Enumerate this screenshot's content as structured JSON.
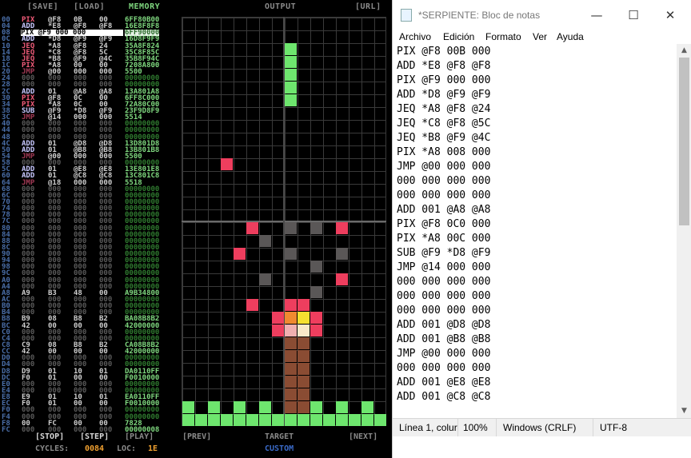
{
  "emulator": {
    "toolbar": {
      "save": "[SAVE]",
      "load": "[LOAD]",
      "memory": "MEMORY",
      "output": "OUTPUT",
      "url": "[URL]"
    },
    "rows": [
      [
        "00",
        "PIX",
        "@F8",
        "0B",
        "00",
        "6FF80B00"
      ],
      [
        "04",
        "ADD",
        "*E8",
        "@F8",
        "@F8",
        "16E8F8F8"
      ],
      [
        "08",
        "PIX",
        "@F9",
        "000",
        "000",
        "6FF90000"
      ],
      [
        "0C",
        "ADD",
        "*D8",
        "@F9",
        "@F9",
        "16D8F9F9"
      ],
      [
        "10",
        "JEQ",
        "*A8",
        "@F8",
        "24",
        "35A8F824"
      ],
      [
        "14",
        "JEQ",
        "*C8",
        "@F8",
        "5C",
        "35C8F85C"
      ],
      [
        "18",
        "JEQ",
        "*B8",
        "@F9",
        "@4C",
        "35B8F94C"
      ],
      [
        "1C",
        "PIX",
        "*A8",
        "00",
        "00",
        "7208A800"
      ],
      [
        "20",
        "JMP",
        "@00",
        "000",
        "000",
        "5500"
      ],
      [
        "24",
        "000",
        "000",
        "000",
        "000",
        "00000000"
      ],
      [
        "28",
        "000",
        "000",
        "000",
        "000",
        "00000000"
      ],
      [
        "2C",
        "ADD",
        "01",
        "@A8",
        "@A8",
        "13A801A8"
      ],
      [
        "30",
        "PIX",
        "@F8",
        "0C",
        "00",
        "6FF8C000"
      ],
      [
        "34",
        "PIX",
        "*A8",
        "0C",
        "00",
        "72A80C00"
      ],
      [
        "38",
        "SUB",
        "@F9",
        "*D8",
        "@F9",
        "23F9D8F9"
      ],
      [
        "3C",
        "JMP",
        "@14",
        "000",
        "000",
        "5514"
      ],
      [
        "40",
        "000",
        "000",
        "000",
        "000",
        "00000000"
      ],
      [
        "44",
        "000",
        "000",
        "000",
        "000",
        "00000000"
      ],
      [
        "48",
        "000",
        "000",
        "000",
        "000",
        "00000000"
      ],
      [
        "4C",
        "ADD",
        "01",
        "@D8",
        "@D8",
        "13D801D8"
      ],
      [
        "50",
        "ADD",
        "01",
        "@B8",
        "@B8",
        "13B801B8"
      ],
      [
        "54",
        "JMP",
        "@00",
        "000",
        "000",
        "5500"
      ],
      [
        "58",
        "000",
        "000",
        "000",
        "000",
        "00000000"
      ],
      [
        "5C",
        "ADD",
        "01",
        "@E8",
        "@E8",
        "13E801E8"
      ],
      [
        "60",
        "ADD",
        "01",
        "@C8",
        "@C8",
        "13C801C8"
      ],
      [
        "64",
        "JMP",
        "@18",
        "000",
        "000",
        "5518"
      ],
      [
        "68",
        "000",
        "000",
        "000",
        "000",
        "00000000"
      ],
      [
        "6C",
        "000",
        "000",
        "000",
        "000",
        "00000000"
      ],
      [
        "70",
        "000",
        "000",
        "000",
        "000",
        "00000000"
      ],
      [
        "74",
        "000",
        "000",
        "000",
        "000",
        "00000000"
      ],
      [
        "78",
        "000",
        "000",
        "000",
        "000",
        "00000000"
      ],
      [
        "7C",
        "000",
        "000",
        "000",
        "000",
        "00000000"
      ],
      [
        "80",
        "000",
        "000",
        "000",
        "000",
        "00000000"
      ],
      [
        "84",
        "000",
        "000",
        "000",
        "000",
        "00000000"
      ],
      [
        "88",
        "000",
        "000",
        "000",
        "000",
        "00000000"
      ],
      [
        "8C",
        "000",
        "000",
        "000",
        "000",
        "00000000"
      ],
      [
        "90",
        "000",
        "000",
        "000",
        "000",
        "00000000"
      ],
      [
        "94",
        "000",
        "000",
        "000",
        "000",
        "00000000"
      ],
      [
        "98",
        "000",
        "000",
        "000",
        "000",
        "00000000"
      ],
      [
        "9C",
        "000",
        "000",
        "000",
        "000",
        "00000000"
      ],
      [
        "A0",
        "000",
        "000",
        "000",
        "000",
        "00000000"
      ],
      [
        "A4",
        "000",
        "000",
        "000",
        "000",
        "00000000"
      ],
      [
        "A8",
        "A9",
        "B3",
        "48",
        "00",
        "A9B34800"
      ],
      [
        "AC",
        "000",
        "000",
        "000",
        "000",
        "00000000"
      ],
      [
        "B0",
        "000",
        "000",
        "000",
        "000",
        "00000000"
      ],
      [
        "B4",
        "000",
        "000",
        "000",
        "000",
        "00000000"
      ],
      [
        "B8",
        "B9",
        "08",
        "B8",
        "B2",
        "BA08B8B2"
      ],
      [
        "BC",
        "42",
        "00",
        "00",
        "00",
        "42000000"
      ],
      [
        "C0",
        "000",
        "000",
        "000",
        "000",
        "00000000"
      ],
      [
        "C4",
        "000",
        "000",
        "000",
        "000",
        "00000000"
      ],
      [
        "C8",
        "C9",
        "08",
        "B8",
        "B2",
        "CA08B8B2"
      ],
      [
        "CC",
        "42",
        "00",
        "00",
        "00",
        "42000000"
      ],
      [
        "D0",
        "000",
        "000",
        "000",
        "000",
        "00000000"
      ],
      [
        "D4",
        "000",
        "000",
        "000",
        "000",
        "00000000"
      ],
      [
        "D8",
        "D9",
        "01",
        "10",
        "01",
        "DA0110FF"
      ],
      [
        "DC",
        "F0",
        "01",
        "00",
        "00",
        "F0010000"
      ],
      [
        "E0",
        "000",
        "000",
        "000",
        "000",
        "00000000"
      ],
      [
        "E4",
        "000",
        "000",
        "000",
        "000",
        "00000000"
      ],
      [
        "E8",
        "E9",
        "01",
        "10",
        "01",
        "EA0110FF"
      ],
      [
        "EC",
        "F0",
        "01",
        "00",
        "00",
        "F0010000"
      ],
      [
        "F0",
        "000",
        "000",
        "000",
        "000",
        "00000000"
      ],
      [
        "F4",
        "000",
        "000",
        "000",
        "000",
        "00000000"
      ],
      [
        "F8",
        "00",
        "FC",
        "00",
        "00",
        "7828"
      ],
      [
        "FC",
        "000",
        "000",
        "000",
        "000",
        "00000008"
      ]
    ],
    "selected_row": 2,
    "selected_text": "PIX @F9 000 000",
    "bottom": {
      "stop": "[STOP]",
      "step": "[STEP]",
      "play": "[PLAY]",
      "prev": "[PREV]",
      "target_label": "TARGET",
      "next": "[NEXT]",
      "cycles_label": "CYCLES:",
      "cycles_value": "0084",
      "loc_label": "LOC:",
      "loc_value": "1E",
      "target_value": "CUSTOM"
    },
    "colors": {
      "green": "#6ee66e",
      "red": "#ee3e5e",
      "gray": "#5a5757",
      "brown": "#8a4c33",
      "orange": "#f08a30",
      "yellow": "#f5e030",
      "cream": "#f8e8c8",
      "pink": "#f0b0b0"
    },
    "pixels": [
      [
        8,
        2,
        "green"
      ],
      [
        8,
        3,
        "green"
      ],
      [
        8,
        4,
        "green"
      ],
      [
        8,
        5,
        "green"
      ],
      [
        8,
        6,
        "green"
      ],
      [
        3,
        11,
        "red"
      ],
      [
        5,
        16,
        "red"
      ],
      [
        8,
        16,
        "gray"
      ],
      [
        10,
        16,
        "gray"
      ],
      [
        12,
        16,
        "red"
      ],
      [
        6,
        17,
        "gray"
      ],
      [
        4,
        18,
        "red"
      ],
      [
        8,
        18,
        "gray"
      ],
      [
        12,
        18,
        "gray"
      ],
      [
        10,
        19,
        "gray"
      ],
      [
        6,
        20,
        "gray"
      ],
      [
        12,
        20,
        "red"
      ],
      [
        10,
        21,
        "gray"
      ],
      [
        5,
        22,
        "red"
      ],
      [
        8,
        22,
        "red"
      ],
      [
        9,
        22,
        "red"
      ],
      [
        7,
        23,
        "red"
      ],
      [
        8,
        23,
        "orange"
      ],
      [
        9,
        23,
        "yellow"
      ],
      [
        10,
        23,
        "red"
      ],
      [
        7,
        24,
        "red"
      ],
      [
        8,
        24,
        "pink"
      ],
      [
        9,
        24,
        "cream"
      ],
      [
        10,
        24,
        "red"
      ],
      [
        8,
        25,
        "brown"
      ],
      [
        9,
        25,
        "brown"
      ],
      [
        8,
        26,
        "brown"
      ],
      [
        9,
        26,
        "brown"
      ],
      [
        8,
        27,
        "brown"
      ],
      [
        9,
        27,
        "brown"
      ],
      [
        8,
        28,
        "brown"
      ],
      [
        9,
        28,
        "brown"
      ],
      [
        8,
        29,
        "brown"
      ],
      [
        9,
        29,
        "brown"
      ],
      [
        8,
        30,
        "brown"
      ],
      [
        9,
        30,
        "brown"
      ],
      [
        0,
        30,
        "green"
      ],
      [
        2,
        30,
        "green"
      ],
      [
        4,
        30,
        "green"
      ],
      [
        6,
        30,
        "green"
      ],
      [
        10,
        30,
        "green"
      ],
      [
        12,
        30,
        "green"
      ],
      [
        14,
        30,
        "green"
      ],
      [
        0,
        31,
        "green"
      ],
      [
        1,
        31,
        "green"
      ],
      [
        2,
        31,
        "green"
      ],
      [
        3,
        31,
        "green"
      ],
      [
        4,
        31,
        "green"
      ],
      [
        5,
        31,
        "green"
      ],
      [
        6,
        31,
        "green"
      ],
      [
        7,
        31,
        "green"
      ],
      [
        8,
        31,
        "green"
      ],
      [
        9,
        31,
        "green"
      ],
      [
        10,
        31,
        "green"
      ],
      [
        11,
        31,
        "green"
      ],
      [
        12,
        31,
        "green"
      ],
      [
        13,
        31,
        "green"
      ],
      [
        14,
        31,
        "green"
      ],
      [
        15,
        31,
        "green"
      ]
    ]
  },
  "notepad": {
    "title": "*SERPIENTE: Bloc de notas",
    "min_glyph": "—",
    "max_glyph": "☐",
    "close_glyph": "✕",
    "menu": [
      "Archivo",
      "Edición",
      "Formato",
      "Ver",
      "Ayuda"
    ],
    "lines": [
      "PIX @F8 00B 000",
      "ADD *E8 @F8 @F8",
      "PIX @F9 000 000",
      "ADD *D8 @F9 @F9",
      "JEQ *A8 @F8 @24",
      "JEQ *C8 @F8 @5C",
      "JEQ *B8 @F9 @4C",
      "PIX *A8 008 000",
      "JMP @00 000 000",
      "000 000 000 000",
      "000 000 000 000",
      "ADD 001 @A8 @A8",
      "PIX @F8 0C0 000",
      "PIX *A8 00C 000",
      "SUB @F9 *D8 @F9",
      "JMP @14 000 000",
      "000 000 000 000",
      "000 000 000 000",
      "000 000 000 000",
      "ADD 001 @D8 @D8",
      "ADD 001 @B8 @B8",
      "JMP @00 000 000",
      "000 000 000 000",
      "ADD 001 @E8 @E8",
      "ADD 001 @C8 @C8"
    ],
    "status": {
      "position": "Línea 1, colur",
      "zoom": "100%",
      "eol": "Windows (CRLF)",
      "encoding": "UTF-8"
    }
  }
}
